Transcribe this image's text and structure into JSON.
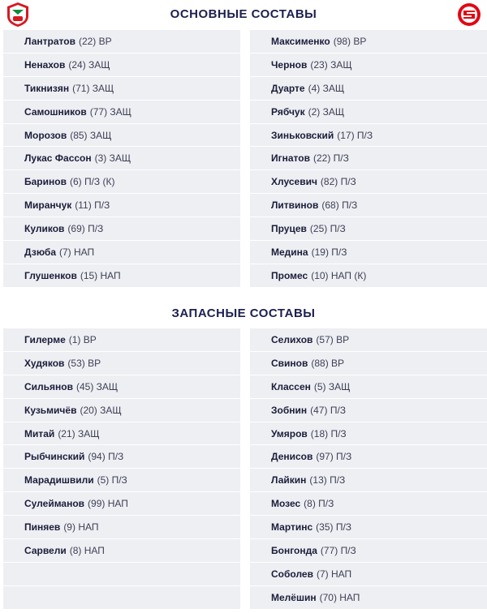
{
  "starters_title": "ОСНОВНЫЕ СОСТАВЫ",
  "subs_title": "ЗАПАСНЫЕ СОСТАВЫ",
  "colors": {
    "title": "#1d1f4f",
    "row_bg": "#eeeff3",
    "lokomotiv_red": "#d71920",
    "lokomotiv_green": "#0a8f3c",
    "spartak_red": "#e30613"
  },
  "home_starters": [
    {
      "name": "Лантратов",
      "meta": "(22) ВР"
    },
    {
      "name": "Ненахов",
      "meta": "(24) ЗАЩ"
    },
    {
      "name": "Тикнизян",
      "meta": "(71) ЗАЩ"
    },
    {
      "name": "Самошников",
      "meta": "(77) ЗАЩ"
    },
    {
      "name": "Морозов",
      "meta": "(85) ЗАЩ"
    },
    {
      "name": "Лукас Фассон",
      "meta": "(3) ЗАЩ"
    },
    {
      "name": "Баринов",
      "meta": "(6) П/З (К)"
    },
    {
      "name": "Миранчук",
      "meta": "(11) П/З"
    },
    {
      "name": "Куликов",
      "meta": "(69) П/З"
    },
    {
      "name": "Дзюба",
      "meta": "(7) НАП"
    },
    {
      "name": "Глушенков",
      "meta": "(15) НАП"
    }
  ],
  "away_starters": [
    {
      "name": "Максименко",
      "meta": "(98) ВР"
    },
    {
      "name": "Чернов",
      "meta": "(23) ЗАЩ"
    },
    {
      "name": "Дуарте",
      "meta": "(4) ЗАЩ"
    },
    {
      "name": "Рябчук",
      "meta": "(2) ЗАЩ"
    },
    {
      "name": "Зиньковский",
      "meta": "(17) П/З"
    },
    {
      "name": "Игнатов",
      "meta": "(22) П/З"
    },
    {
      "name": "Хлусевич",
      "meta": "(82) П/З"
    },
    {
      "name": "Литвинов",
      "meta": "(68) П/З"
    },
    {
      "name": "Пруцев",
      "meta": "(25) П/З"
    },
    {
      "name": "Медина",
      "meta": "(19) П/З"
    },
    {
      "name": "Промес",
      "meta": "(10) НАП (К)"
    }
  ],
  "home_subs": [
    {
      "name": "Гилерме",
      "meta": "(1) ВР"
    },
    {
      "name": "Худяков",
      "meta": "(53) ВР"
    },
    {
      "name": "Сильянов",
      "meta": "(45) ЗАЩ"
    },
    {
      "name": "Кузьмичёв",
      "meta": "(20) ЗАЩ"
    },
    {
      "name": "Митай",
      "meta": "(21) ЗАЩ"
    },
    {
      "name": "Рыбчинский",
      "meta": "(94) П/З"
    },
    {
      "name": "Марадишвили",
      "meta": "(5) П/З"
    },
    {
      "name": "Сулейманов",
      "meta": "(99) НАП"
    },
    {
      "name": "Пиняев",
      "meta": "(9) НАП"
    },
    {
      "name": "Сарвели",
      "meta": "(8) НАП"
    }
  ],
  "away_subs": [
    {
      "name": "Селихов",
      "meta": "(57) ВР"
    },
    {
      "name": "Свинов",
      "meta": "(88) ВР"
    },
    {
      "name": "Классен",
      "meta": "(5) ЗАЩ"
    },
    {
      "name": "Зобнин",
      "meta": "(47) П/З"
    },
    {
      "name": "Умяров",
      "meta": "(18) П/З"
    },
    {
      "name": "Денисов",
      "meta": "(97) П/З"
    },
    {
      "name": "Лайкин",
      "meta": "(13) П/З"
    },
    {
      "name": "Мозес",
      "meta": "(8) П/З"
    },
    {
      "name": "Мартинс",
      "meta": "(35) П/З"
    },
    {
      "name": "Бонгонда",
      "meta": "(77) П/З"
    },
    {
      "name": "Соболев",
      "meta": "(7) НАП"
    },
    {
      "name": "Мелёшин",
      "meta": "(70) НАП"
    }
  ]
}
